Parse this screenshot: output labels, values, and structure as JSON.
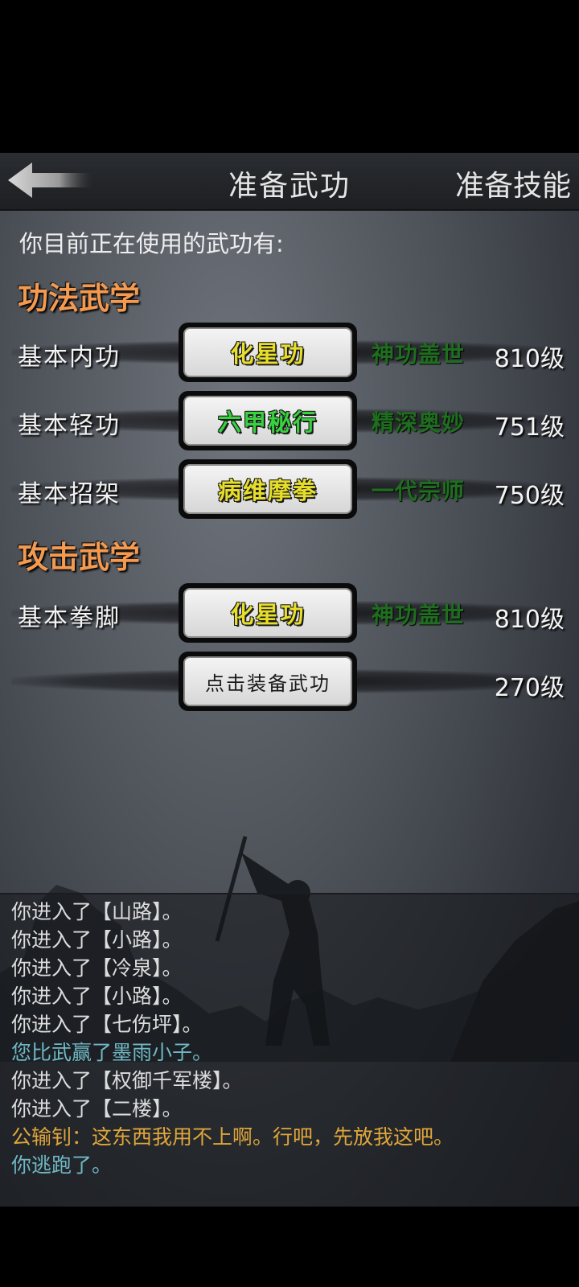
{
  "header": {
    "title": "准备武功",
    "skills_link": "准备技能",
    "back_icon": "back-arrow-icon"
  },
  "intro": "你目前正在使用的武功有:",
  "sections": {
    "internal": "功法武学",
    "attack": "攻击武学"
  },
  "rows": [
    {
      "slot": "基本内功",
      "martial": "化星功",
      "rank": "神功盖世",
      "level": "810级",
      "color": "yellow"
    },
    {
      "slot": "基本轻功",
      "martial": "六甲秘行",
      "rank": "精深奥妙",
      "level": "751级",
      "color": "green"
    },
    {
      "slot": "基本招架",
      "martial": "病维摩拳",
      "rank": "一代宗师",
      "level": "750级",
      "color": "yellow"
    },
    {
      "slot": "基本拳脚",
      "martial": "化星功",
      "rank": "神功盖世",
      "level": "810级",
      "color": "yellow"
    },
    {
      "slot": "",
      "martial": "点击装备武功",
      "rank": "",
      "level": "270级",
      "color": "plain"
    }
  ],
  "log": [
    {
      "text": "你进入了【山路】。",
      "type": "normal"
    },
    {
      "text": "你进入了【小路】。",
      "type": "normal"
    },
    {
      "text": "你进入了【冷泉】。",
      "type": "normal"
    },
    {
      "text": "你进入了【小路】。",
      "type": "normal"
    },
    {
      "text": "你进入了【七伤坪】。",
      "type": "normal"
    },
    {
      "text": "您比武赢了墨雨小子。",
      "type": "win"
    },
    {
      "text": "你进入了【权御千军楼】。",
      "type": "normal"
    },
    {
      "text": "你进入了【二楼】。",
      "type": "normal"
    },
    {
      "text": "公输钊：这东西我用不上啊。行吧，先放我这吧。",
      "type": "npc"
    },
    {
      "text": "你逃跑了。",
      "type": "win"
    }
  ],
  "colors": {
    "section": "#f39a50",
    "rank": "#1f6e1f",
    "name_yellow": "#e6de2a",
    "name_green": "#38d13f",
    "log_win": "#6fb8c4",
    "log_npc": "#e0a63a"
  }
}
